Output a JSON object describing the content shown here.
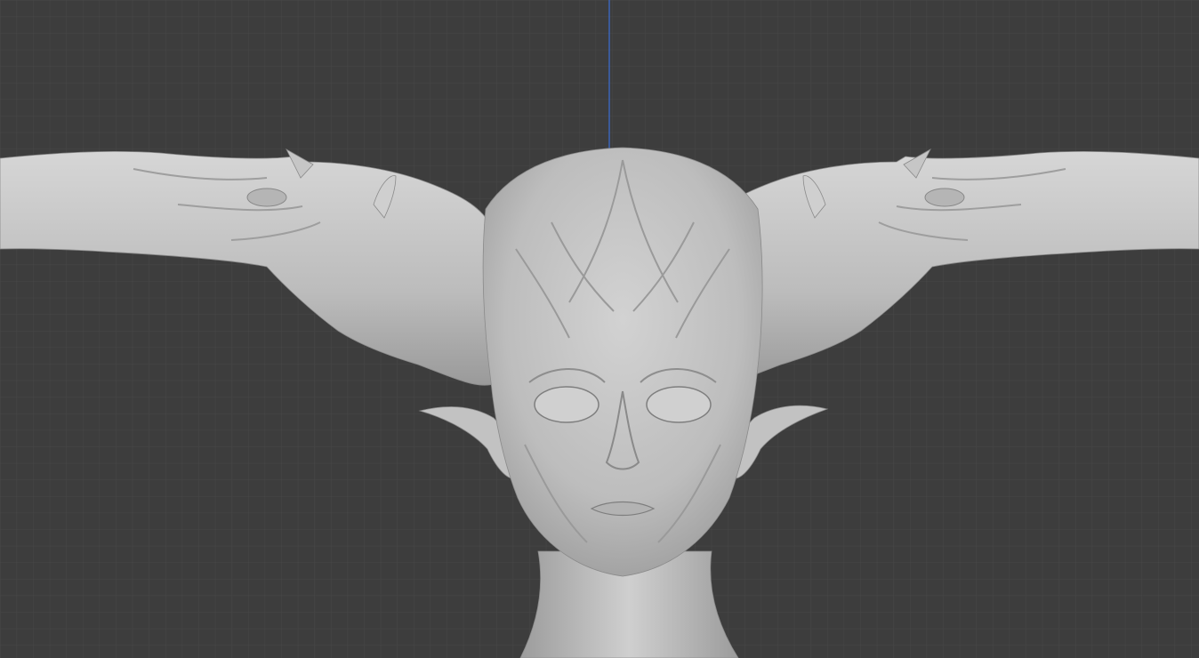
{
  "viewport": {
    "background_color": "#3d3d3d",
    "grid_minor_color": "#474747",
    "grid_major_color": "#525252",
    "axis_z_color": "#3b6fd6",
    "mesh_color": "#c4c4c4",
    "mesh_shadow_color": "#8e8e8e",
    "mesh_highlight_color": "#e6e6e6"
  },
  "mesh": {
    "name_hint": "sculpted-alien-creature-bust",
    "view": "front-orthographic"
  }
}
